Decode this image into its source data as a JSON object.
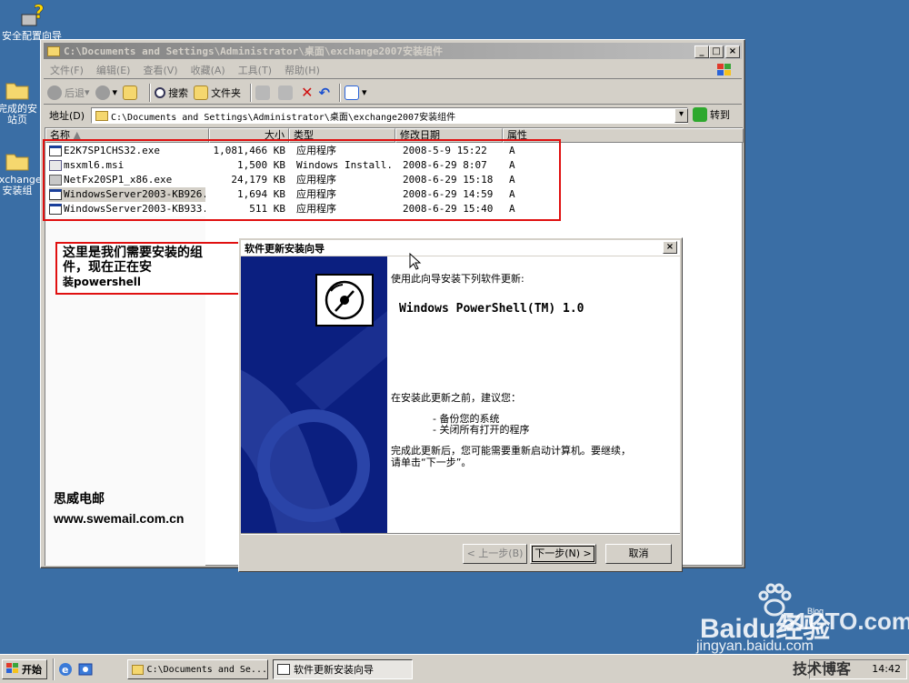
{
  "desktop": {
    "icons": [
      {
        "label": "安全配置向导",
        "icon": "security-wizard-icon"
      },
      {
        "label": "完成的安",
        "label2": "站页",
        "icon": "folder-icon"
      },
      {
        "label": "exchange",
        "label2": "安装组",
        "icon": "folder-icon"
      }
    ]
  },
  "explorer": {
    "title": "C:\\Documents and Settings\\Administrator\\桌面\\exchange2007安装组件",
    "menu": [
      "文件(F)",
      "编辑(E)",
      "查看(V)",
      "收藏(A)",
      "工具(T)",
      "帮助(H)"
    ],
    "toolbar": {
      "back": "后退",
      "search": "搜索",
      "folders": "文件夹"
    },
    "address_label": "地址(D)",
    "address_value": "C:\\Documents and Settings\\Administrator\\桌面\\exchange2007安装组件",
    "goto": "转到",
    "columns": [
      "名称",
      "大小",
      "类型",
      "修改日期",
      "属性"
    ],
    "files": [
      {
        "name": "E2K7SP1CHS32.exe",
        "size": "1,081,466 KB",
        "type": "应用程序",
        "date": "2008-5-9 15:22",
        "attr": "A"
      },
      {
        "name": "msxml6.msi",
        "size": "1,500 KB",
        "type": "Windows Install...",
        "date": "2008-6-29 8:07",
        "attr": "A"
      },
      {
        "name": "NetFx20SP1_x86.exe",
        "size": "24,179 KB",
        "type": "应用程序",
        "date": "2008-6-29 15:18",
        "attr": "A"
      },
      {
        "name": "WindowsServer2003-KB926...",
        "size": "1,694 KB",
        "type": "应用程序",
        "date": "2008-6-29 14:59",
        "attr": "A"
      },
      {
        "name": "WindowsServer2003-KB933...",
        "size": "511 KB",
        "type": "应用程序",
        "date": "2008-6-29 15:40",
        "attr": "A"
      }
    ]
  },
  "annotation": {
    "line1": "这里是我们需要安装的组",
    "line2": "件，现在正在安",
    "line3": "装powershell"
  },
  "watermark": {
    "company": "思威电邮",
    "url": "www.swemail.com.cn",
    "baidu": "Baidu经验",
    "baidu_sub": "jingyan.baidu.com",
    "site": "51CTO.com",
    "site_sub": "技术博客",
    "site_tag": "Blog"
  },
  "wizard": {
    "title": "软件更新安装向导",
    "intro": "使用此向导安装下列软件更新:",
    "product": "Windows PowerShell(TM) 1.0",
    "recommend": "在安装此更新之前，建议您：",
    "bullet1": "- 备份您的系统",
    "bullet2": "- 关闭所有打开的程序",
    "restart1": "完成此更新后，您可能需要重新启动计算机。要继续，",
    "restart2": "请单击“下一步”。",
    "back_btn": "< 上一步(B)",
    "next_btn": "下一步(N) >",
    "cancel_btn": "取消"
  },
  "taskbar": {
    "start": "开始",
    "tasks": [
      "C:\\Documents and Se...",
      "软件更新安装向导"
    ],
    "clock": "14:42"
  }
}
